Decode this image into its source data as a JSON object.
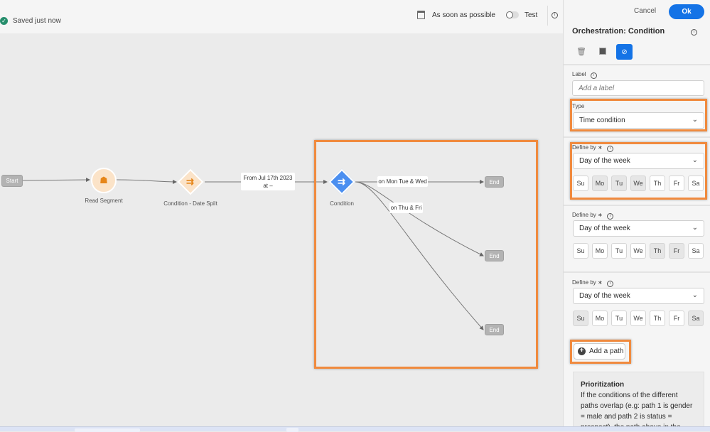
{
  "header": {
    "saved_status": "Saved just now",
    "schedule": "As soon as possible",
    "test_label": "Test",
    "test_toggle_on": false
  },
  "canvas": {
    "start": "Start",
    "read_segment": "Read Segment",
    "date_split": "Condition - Date Spilt",
    "date_edge_label": "From Jul 17th 2023 at –",
    "condition": "Condition",
    "edge1": "on Mon Tue & Wed",
    "edge2": "on Thu & Fri",
    "end": "End"
  },
  "panel": {
    "cancel": "Cancel",
    "ok": "Ok",
    "title": "Orchestration: Condition",
    "label_label": "Label",
    "label_placeholder": "Add a label",
    "type_label": "Type",
    "type_value": "Time condition",
    "paths": [
      {
        "define_label": "Define by ∗",
        "value": "Day of the week",
        "days": [
          {
            "d": "Su",
            "s": false
          },
          {
            "d": "Mo",
            "s": true
          },
          {
            "d": "Tu",
            "s": true
          },
          {
            "d": "We",
            "s": true
          },
          {
            "d": "Th",
            "s": false
          },
          {
            "d": "Fr",
            "s": false
          },
          {
            "d": "Sa",
            "s": false
          }
        ]
      },
      {
        "define_label": "Define by ∗",
        "value": "Day of the week",
        "days": [
          {
            "d": "Su",
            "s": false
          },
          {
            "d": "Mo",
            "s": false
          },
          {
            "d": "Tu",
            "s": false
          },
          {
            "d": "We",
            "s": false
          },
          {
            "d": "Th",
            "s": true
          },
          {
            "d": "Fr",
            "s": true
          },
          {
            "d": "Sa",
            "s": false
          }
        ]
      },
      {
        "define_label": "Define by ∗",
        "value": "Day of the week",
        "days": [
          {
            "d": "Su",
            "s": true
          },
          {
            "d": "Mo",
            "s": false
          },
          {
            "d": "Tu",
            "s": false
          },
          {
            "d": "We",
            "s": false
          },
          {
            "d": "Th",
            "s": false
          },
          {
            "d": "Fr",
            "s": false
          },
          {
            "d": "Sa",
            "s": true
          }
        ]
      }
    ],
    "add_path": "Add a path",
    "prio_title": "Prioritization",
    "prio_text": "If the conditions of the different paths overlap (e.g: path 1 is gender = male and path 2 is status = prospect), the path above in the canvas will always be"
  },
  "colors": {
    "accent": "#1473e6",
    "highlight": "#f08a3e",
    "node_orange": "#e68619"
  }
}
